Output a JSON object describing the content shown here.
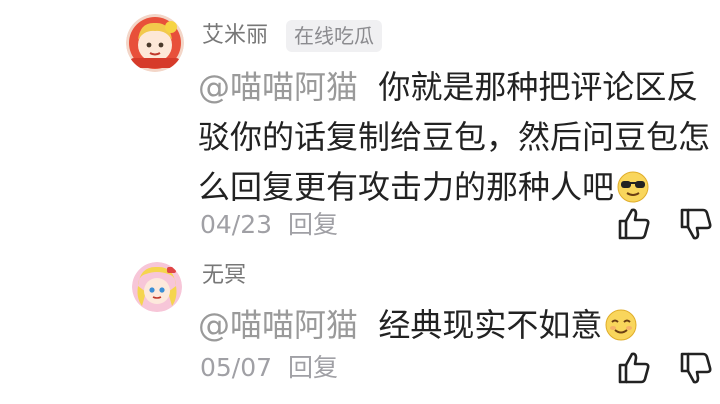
{
  "comments": [
    {
      "username": "艾米丽",
      "badge": "在线吃瓜",
      "mention": "@喵喵阿猫",
      "lines": [
        "你就是那种把评论区反",
        "驳你的话复制给豆包，然后问豆包怎",
        "么回复更有攻击力的那种人吧"
      ],
      "emoji_icon": "cool-sunglasses-emoji",
      "date": "04/23",
      "reply_label": "回复"
    },
    {
      "username": "无冥",
      "mention": "@喵喵阿猫",
      "text": "经典现实不如意",
      "emoji_icon": "relieved-smile-emoji",
      "date": "05/07",
      "reply_label": "回复"
    }
  ],
  "icons": {
    "like": "thumbs-up-icon",
    "dislike": "thumbs-down-icon"
  },
  "colors": {
    "text": "#222222",
    "secondary": "#777777",
    "muted": "#a0a0a5",
    "badge_bg": "#f0f0f2"
  }
}
